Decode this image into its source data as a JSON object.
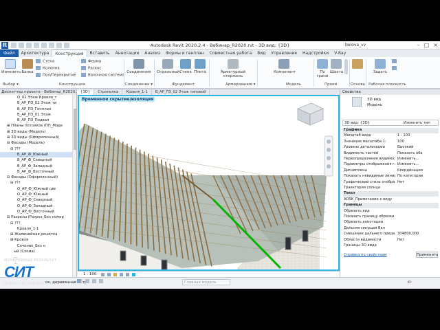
{
  "titlebar": {
    "title": "Autodesk Revit 2020.2.4 - Вебинар_R2020.rvt - 3D вид: {3D}",
    "user": "belova_vv",
    "logo": "R"
  },
  "tabs": [
    "Файл",
    "Архитектура",
    "Конструкция",
    "Вставить",
    "Аннотации",
    "Анализ",
    "Формы и генплан",
    "Совместная работа",
    "Вид",
    "Управление",
    "Надстройки",
    "V-Ray"
  ],
  "ribbon": {
    "modify": "Изменить",
    "beam": "Балка",
    "wall": "Стена",
    "column": "Колонна",
    "floor": "Пол/Перекрытие",
    "truss": "Ферма",
    "brace": "Раскос",
    "beam_system": "Балочная система",
    "connection": "Соединение",
    "isolated": "Отдельный",
    "wall_f": "Стена",
    "slab": "Плита",
    "rebar": "Арматурный стержень",
    "component": "Компонент",
    "by_face": "По грани",
    "shaft": "Шахта",
    "set": "Задать",
    "groups": {
      "select": "Выбор ▾",
      "structure": "Конструкция",
      "connection": "Соединение ▾",
      "foundation": "Фундамент",
      "reinforcement": "Армирование ▾",
      "model": "Модель",
      "openings": "Проем",
      "datum": "Основа",
      "workplane": "Рабочая плоскость"
    }
  },
  "project_browser": {
    "title": "Диспетчер проекта - Вебинар_R2020...",
    "items": [
      {
        "t": "О_02 Этаж Кровля_т",
        "i": 5,
        "s": false
      },
      {
        "t": "В_АР_ПЗ_02 Этаж ти",
        "i": 5,
        "s": false
      },
      {
        "t": "В_АР_ПЗ_Генплан",
        "i": 5,
        "s": false
      },
      {
        "t": "В_АР_ПЗ_01 Этаж",
        "i": 5,
        "s": false
      },
      {
        "t": "В_АР_ПЗ_Подвал",
        "i": 5,
        "s": false
      },
      {
        "t": "⊞ Планы потолков (ПП_Моде",
        "i": 2,
        "s": false
      },
      {
        "t": "⊞ 3D виды (Модель)",
        "i": 2,
        "s": false
      },
      {
        "t": "⊞ 3D виды (Оформленный)",
        "i": 2,
        "s": false
      },
      {
        "t": "⊟ Фасады (Модель)",
        "i": 2,
        "s": false
      },
      {
        "t": "⊟ ???",
        "i": 3,
        "s": false
      },
      {
        "t": "В_АР_Ф_Южный",
        "i": 5,
        "s": true
      },
      {
        "t": "В_АР_Ф_Северный",
        "i": 5,
        "s": false
      },
      {
        "t": "В_АР_Ф_Западный",
        "i": 5,
        "s": false
      },
      {
        "t": "В_АР_Ф_Восточный",
        "i": 5,
        "s": false
      },
      {
        "t": "⊟ Фасады (Оформленный)",
        "i": 2,
        "s": false
      },
      {
        "t": "⊟ ???",
        "i": 3,
        "s": false
      },
      {
        "t": "О_АР_Ф_Южный цвє",
        "i": 5,
        "s": false
      },
      {
        "t": "О_АР_Ф_Южный",
        "i": 5,
        "s": false
      },
      {
        "t": "О_АР_Ф_Северный",
        "i": 5,
        "s": false
      },
      {
        "t": "О_АР_Ф_Западный",
        "i": 5,
        "s": false
      },
      {
        "t": "О_АР_Ф_Восточный",
        "i": 5,
        "s": false
      },
      {
        "t": "⊟ Разрезы (Разрез_Без номер",
        "i": 2,
        "s": false
      },
      {
        "t": "⊟ ???",
        "i": 3,
        "s": false
      },
      {
        "t": "Кровля_1-1",
        "i": 5,
        "s": false
      },
      {
        "t": "⊞ Жалюзийная решетка",
        "i": 3,
        "s": false
      },
      {
        "t": "⊞ Кровля",
        "i": 3,
        "s": false
      },
      {
        "t": "Сечение_Без н",
        "i": 5,
        "s": false
      },
      {
        "t": "ый (Схема)",
        "i": 4,
        "s": false
      },
      {
        "t": "...",
        "i": 4,
        "s": false
      },
      {
        "t": "...",
        "i": 4,
        "s": false
      },
      {
        "t": "...",
        "i": 4,
        "s": false
      },
      {
        "t": "...",
        "i": 4,
        "s": false
      }
    ]
  },
  "view_tabs": [
    "{3D}",
    "Стропилка",
    "Кровля_1-1",
    "В_АР_ПЗ_02 Этаж типовой"
  ],
  "viewport": {
    "temp_label": "Временное скрытие/изоляция",
    "scale": "1 : 100"
  },
  "properties": {
    "title": "Свойства",
    "type_name": "3D вид",
    "type_sub": "Модель",
    "selector": "3D вид: {3D}",
    "edit_type": "Изменить тип",
    "rows": [
      {
        "k": "Графика",
        "v": "",
        "sec": true
      },
      {
        "k": "Масштаб вида",
        "v": "1 : 100",
        "sec": false
      },
      {
        "k": "Значение масштаба   1:",
        "v": "100",
        "sec": false
      },
      {
        "k": "Уровень детализации",
        "v": "Высокий",
        "sec": false
      },
      {
        "k": "Видимость частей",
        "v": "Показать оба",
        "sec": false
      },
      {
        "k": "Переопределения видимос...",
        "v": "Изменить...",
        "sec": false
      },
      {
        "k": "Параметры отображения г...",
        "v": "Изменить...",
        "sec": false
      },
      {
        "k": "Дисциплина",
        "v": "Координация",
        "sec": false
      },
      {
        "k": "Показать невидимые линии",
        "v": "По категории",
        "sec": false
      },
      {
        "k": "Графический стиль отобра...",
        "v": "Нет",
        "sec": false
      },
      {
        "k": "Траектория солнца",
        "v": "",
        "sec": false
      },
      {
        "k": "Текст",
        "v": "",
        "sec": true
      },
      {
        "k": "ADSK_Примечание к виду",
        "v": "",
        "sec": false
      },
      {
        "k": "Границы",
        "v": "",
        "sec": true
      },
      {
        "k": "Обрезать вид",
        "v": "",
        "sec": false
      },
      {
        "k": "Показать границу обрезки",
        "v": "",
        "sec": false
      },
      {
        "k": "Обрезать аннотации",
        "v": "",
        "sec": false
      },
      {
        "k": "Дальняя секущая Вкл",
        "v": "",
        "sec": false
      },
      {
        "k": "Смещение дальнего преде...",
        "v": "304800,000",
        "sec": false
      },
      {
        "k": "Области видимости",
        "v": "Нет",
        "sec": false
      },
      {
        "k": "Границы 3D вида",
        "v": "",
        "sec": false
      }
    ],
    "help_link": "Справка по свойствам",
    "apply": "Применить"
  },
  "status": {
    "hint": "ок, деревянная : Стр",
    "model": "Главная модель",
    "zero": ":0"
  },
  "watermark": {
    "line1": "ИЗМЕРЯЕМЫЙ РЕЗУЛЬТАТ",
    "logo": "СИТ",
    "line2": "ЗА КАЧЕСТВО ОТВЕЧАЕМ"
  }
}
